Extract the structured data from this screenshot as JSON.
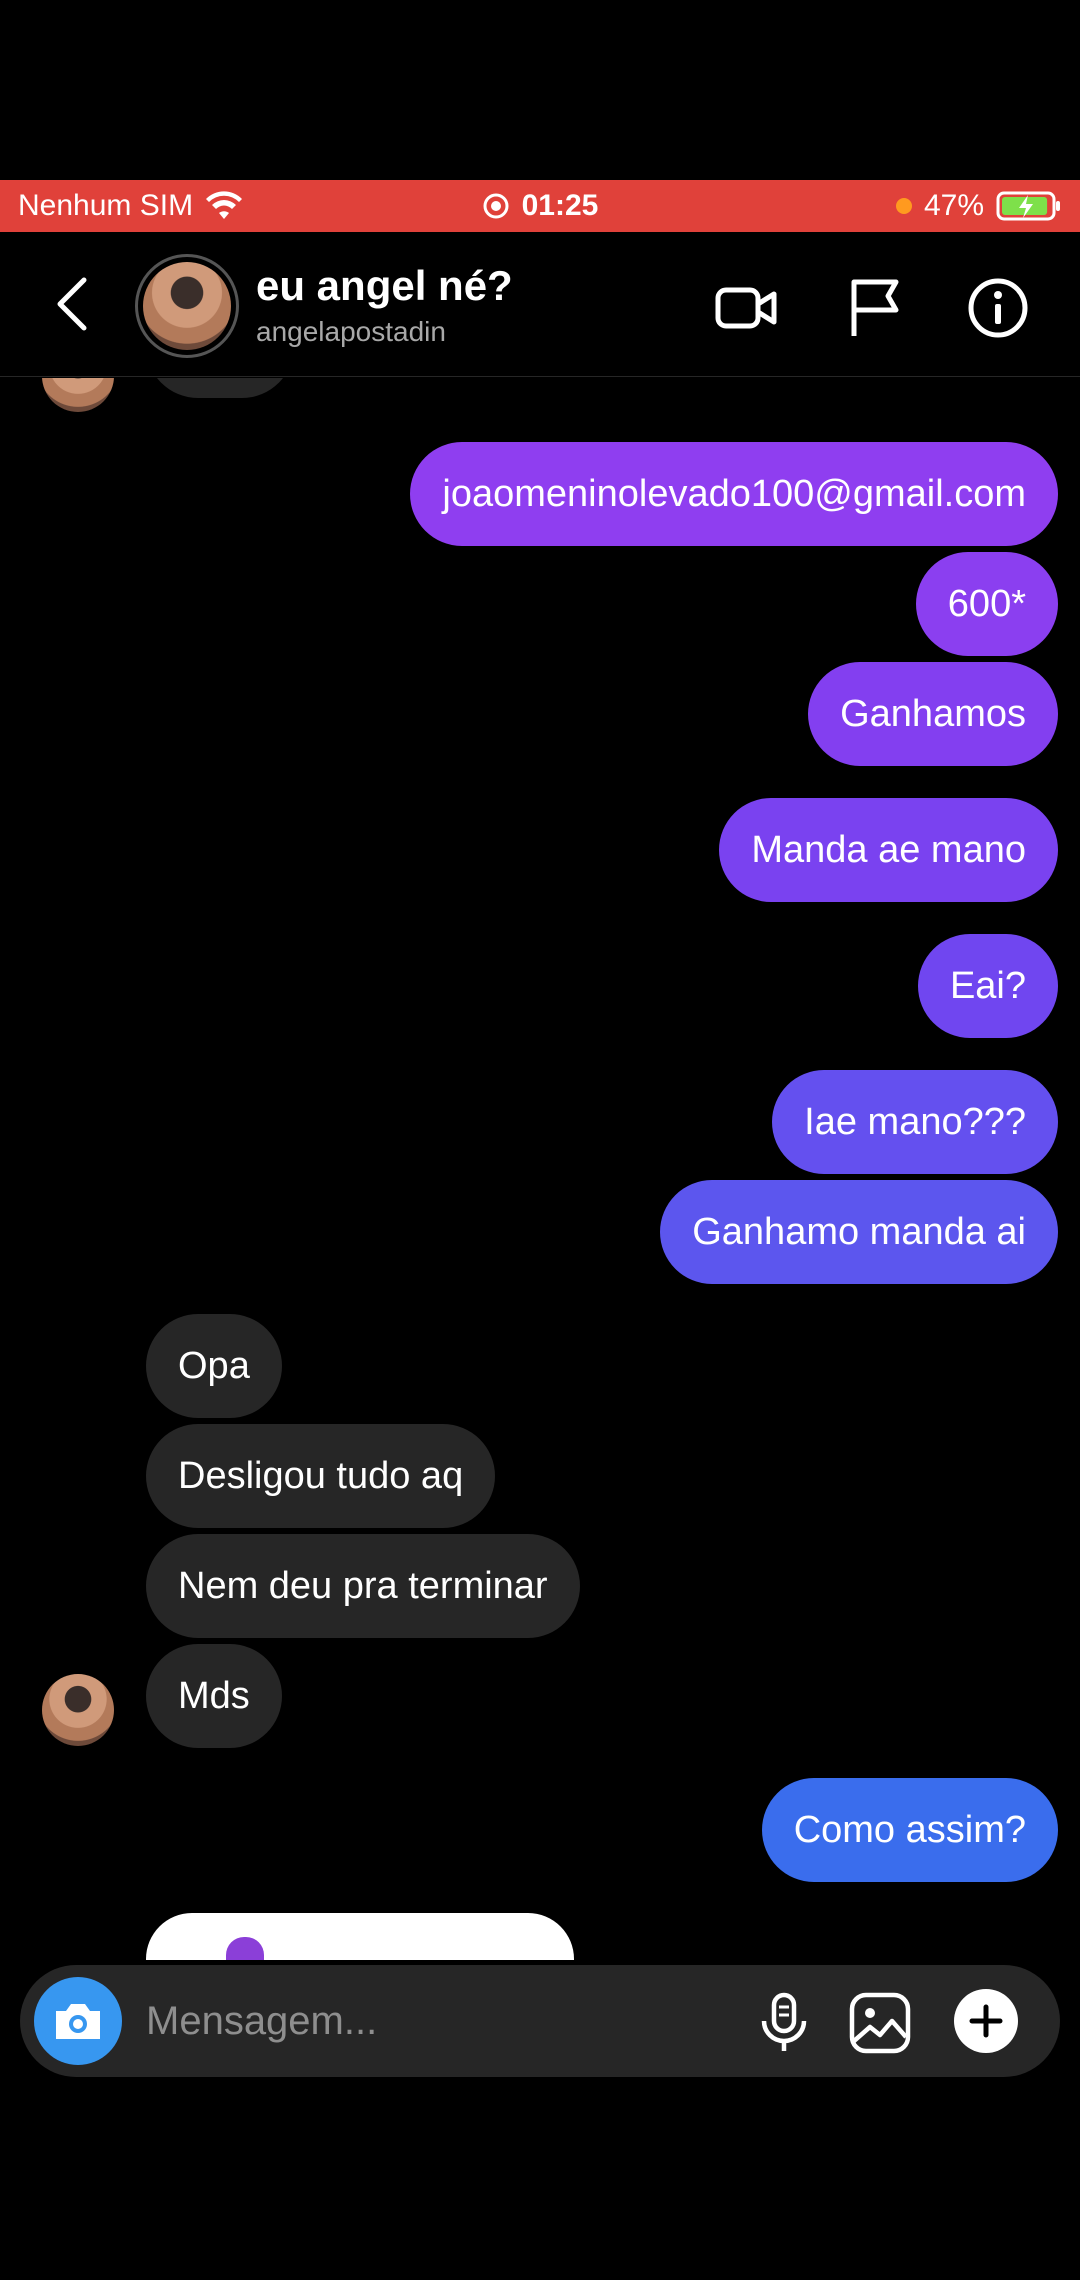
{
  "status_bar": {
    "carrier": "Nenhum SIM",
    "time": "01:25",
    "battery": "47%",
    "battery_level": 0.47,
    "bar_color": "#e0413a"
  },
  "header": {
    "title": "eu angel né?",
    "username": "angelapostadin"
  },
  "messages": [
    {
      "side": "out",
      "text": "joaomeninolevado100@gmail.com",
      "color": "#8f3ef0"
    },
    {
      "side": "out",
      "text": "600*",
      "color": "#8b3ff0"
    },
    {
      "side": "out",
      "text": "Ganhamos",
      "color": "#833ff0"
    },
    {
      "side": "out",
      "text": "Manda ae mano",
      "color": "#7a42f0"
    },
    {
      "side": "out",
      "text": "Eai?",
      "color": "#7046f0"
    },
    {
      "side": "out",
      "text": "Iae mano???",
      "color": "#6450ef"
    },
    {
      "side": "out",
      "text": "Ganhamo manda ai",
      "color": "#5c56ee"
    },
    {
      "side": "in",
      "text": "Opa"
    },
    {
      "side": "in",
      "text": "Desligou tudo aq"
    },
    {
      "side": "in",
      "text": "Nem deu pra terminar"
    },
    {
      "side": "in",
      "text": "Mds"
    },
    {
      "side": "out",
      "text": "Como assim?",
      "color": "#3a6ded"
    }
  ],
  "composer": {
    "placeholder": "Mensagem..."
  },
  "colors": {
    "incoming_bubble": "#262626",
    "camera_button": "#3797f0"
  }
}
